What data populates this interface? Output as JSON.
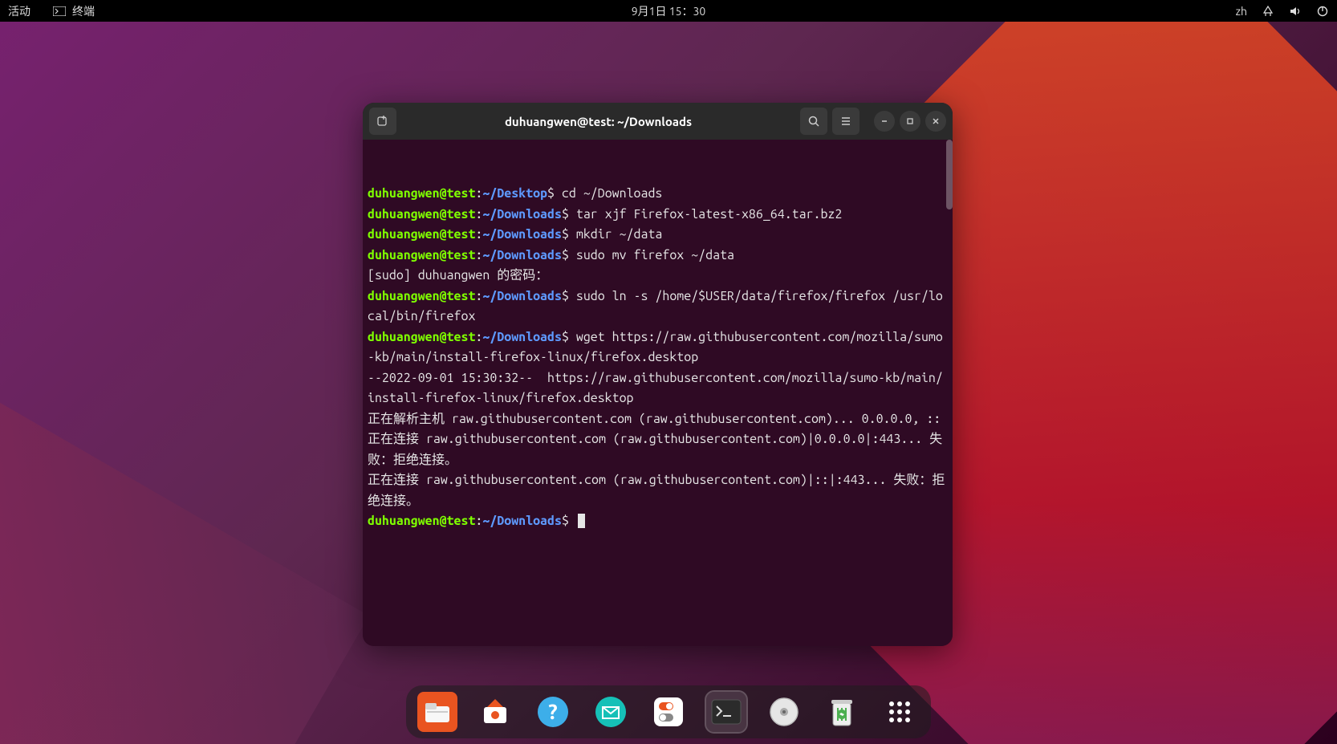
{
  "topbar": {
    "activities": "活动",
    "appname": "终端",
    "datetime": "9月1日 15：30",
    "lang": "zh"
  },
  "terminal": {
    "title": "duhuangwen@test: ~/Downloads",
    "prompt": {
      "userhost": "duhuangwen@test",
      "sep": ":",
      "path_desktop": "~/Desktop",
      "path_downloads": "~/Downloads",
      "dollar": "$"
    },
    "lines": {
      "cmd1": " cd ~/Downloads",
      "cmd2": " tar xjf Firefox-latest-x86_64.tar.bz2",
      "cmd3": " mkdir ~/data",
      "cmd4": " sudo mv firefox ~/data",
      "out_sudo": "[sudo] duhuangwen 的密码：",
      "cmd5": " sudo ln -s /home/$USER/data/firefox/firefox /usr/local/bin/firefox",
      "cmd6": " wget https://raw.githubusercontent.com/mozilla/sumo-kb/main/install-firefox-linux/firefox.desktop",
      "wget_ts": "--2022-09-01 15:30:32--  https://raw.githubusercontent.com/mozilla/sumo-kb/main/install-firefox-linux/firefox.desktop",
      "wget_resolve": "正在解析主机 raw.githubusercontent.com (raw.githubusercontent.com)... 0.0.0.0, ::",
      "wget_conn1": "正在连接 raw.githubusercontent.com (raw.githubusercontent.com)|0.0.0.0|:443... 失败：拒绝连接。",
      "wget_conn2": "正在连接 raw.githubusercontent.com (raw.githubusercontent.com)|::|:443... 失败：拒绝连接。"
    }
  },
  "dock": {
    "items": [
      "files",
      "software",
      "help",
      "email",
      "settings",
      "terminal",
      "disk",
      "trash",
      "apps"
    ]
  }
}
